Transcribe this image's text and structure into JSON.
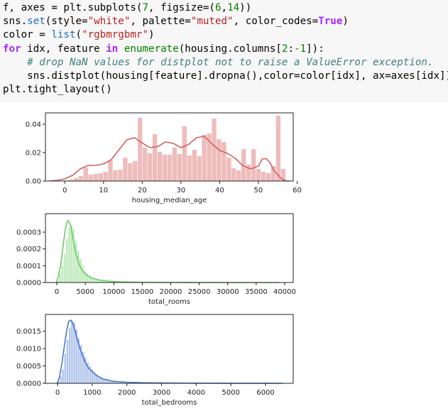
{
  "code": {
    "lines": [
      [
        {
          "t": "f, axes = plt.subplots(",
          "c": ""
        },
        {
          "t": "7",
          "c": "n"
        },
        {
          "t": ", figsize=(",
          "c": ""
        },
        {
          "t": "6",
          "c": "n"
        },
        {
          "t": ",",
          "c": ""
        },
        {
          "t": "14",
          "c": "n"
        },
        {
          "t": "))",
          "c": ""
        }
      ],
      [
        {
          "t": "sns.",
          "c": ""
        },
        {
          "t": "set",
          "c": "bl"
        },
        {
          "t": "(style=",
          "c": ""
        },
        {
          "t": "\"white\"",
          "c": "s"
        },
        {
          "t": ", palette=",
          "c": ""
        },
        {
          "t": "\"muted\"",
          "c": "s"
        },
        {
          "t": ", color_codes=",
          "c": ""
        },
        {
          "t": "True",
          "c": "kw"
        },
        {
          "t": ")",
          "c": ""
        }
      ],
      [
        {
          "t": "color = ",
          "c": ""
        },
        {
          "t": "list",
          "c": "bl"
        },
        {
          "t": "(",
          "c": ""
        },
        {
          "t": "\"rgbmrgbmr\"",
          "c": "s"
        },
        {
          "t": ")",
          "c": ""
        }
      ],
      [
        {
          "t": "for",
          "c": "kw"
        },
        {
          "t": " idx, feature ",
          "c": ""
        },
        {
          "t": "in",
          "c": "kw"
        },
        {
          "t": " ",
          "c": ""
        },
        {
          "t": "enumerate",
          "c": "b"
        },
        {
          "t": "(housing.columns[",
          "c": ""
        },
        {
          "t": "2",
          "c": "n"
        },
        {
          "t": ":",
          "c": ""
        },
        {
          "t": "-1",
          "c": "n"
        },
        {
          "t": "]):",
          "c": ""
        }
      ],
      [
        {
          "t": "    ",
          "c": ""
        },
        {
          "t": "# drop NaN values for distplot not to raise a ValueError exception.",
          "c": "c"
        }
      ],
      [
        {
          "t": "    sns.distplot(housing[feature].dropna(),color=color[idx], ax=axes[idx])",
          "c": ""
        }
      ],
      [
        {
          "t": "plt.tight_layout()",
          "c": ""
        }
      ]
    ]
  },
  "chart_data": [
    {
      "type": "histogram+kde",
      "xlabel": "housing_median_age",
      "ylabel": "",
      "color": "#d65f5f",
      "xlim": [
        -5,
        59
      ],
      "ylim": [
        0,
        0.048
      ],
      "xticks": [
        "0",
        "10",
        "20",
        "30",
        "40",
        "50",
        "60"
      ],
      "yticks": [
        "0.00",
        "0.02",
        "0.04"
      ],
      "bin_start": 1,
      "bin_width": 1.275,
      "hist_values": [
        0.001,
        0.002,
        0.0035,
        0.0095,
        0.0045,
        0.005,
        0.0055,
        0.0065,
        0.0145,
        0.0075,
        0.008,
        0.0165,
        0.0125,
        0.014,
        0.0445,
        0.0235,
        0.0195,
        0.033,
        0.0205,
        0.0185,
        0.0185,
        0.0235,
        0.019,
        0.0385,
        0.018,
        0.022,
        0.0175,
        0.0325,
        0.0335,
        0.044,
        0.0295,
        0.0275,
        0.0165,
        0.009,
        0.0075,
        0.0225,
        0.0115,
        0.0225,
        0.0085,
        0.0065,
        0.0055,
        0.0105,
        0.046,
        0.0085
      ],
      "kde_x": [
        -4,
        -2,
        0,
        2,
        4,
        6,
        8,
        10,
        12,
        14,
        16,
        18,
        20,
        22,
        24,
        26,
        28,
        30,
        32,
        34,
        36,
        38,
        40,
        42,
        44,
        46,
        48,
        50,
        51,
        52,
        53,
        54,
        56,
        57,
        58
      ],
      "kde_y": [
        0,
        0.0005,
        0.0015,
        0.004,
        0.0085,
        0.011,
        0.011,
        0.012,
        0.015,
        0.022,
        0.029,
        0.0305,
        0.0268,
        0.0235,
        0.0242,
        0.0275,
        0.0265,
        0.0235,
        0.0258,
        0.0305,
        0.0315,
        0.0262,
        0.0215,
        0.0195,
        0.016,
        0.0108,
        0.0085,
        0.0105,
        0.0155,
        0.0158,
        0.013,
        0.0075,
        0.0015,
        0.0003,
        0
      ]
    },
    {
      "type": "histogram+kde",
      "xlabel": "total_rooms",
      "ylabel": "",
      "color": "#6acc65",
      "xlim": [
        -2000,
        41500
      ],
      "ylim": [
        0,
        0.00041
      ],
      "xticks": [
        "0",
        "5000",
        "10000",
        "15000",
        "20000",
        "25000",
        "30000",
        "35000",
        "40000"
      ],
      "yticks": [
        "0.0000",
        "0.0001",
        "0.0002",
        "0.0003"
      ],
      "bin_start": 0,
      "bin_width": 400,
      "hist_values": [
        1e-05,
        5e-05,
        0.0001,
        0.00017,
        0.00026,
        0.00033,
        0.00034,
        0.00032,
        0.00025,
        0.00019,
        0.00014,
        0.0001,
        7e-05,
        5e-05,
        4e-05,
        3e-05,
        2.5e-05,
        2e-05,
        1.5e-05,
        1e-05,
        8e-06,
        6e-06,
        5e-06,
        4e-06,
        3e-06,
        3e-06,
        2e-06,
        2e-06
      ],
      "kde_x": [
        -100,
        300,
        700,
        1100,
        1500,
        1900,
        2200,
        2500,
        2900,
        3300,
        3800,
        4300,
        5000,
        6000,
        7500,
        9000,
        11000,
        14000,
        18000,
        24000,
        30000,
        35000,
        39000
      ],
      "kde_y": [
        0,
        4e-05,
        0.00011,
        0.00022,
        0.00032,
        0.00037,
        0.00036,
        0.00033,
        0.00025,
        0.00018,
        0.00012,
        8e-05,
        5e-05,
        2.8e-05,
        1.5e-05,
        8e-06,
        4e-06,
        2e-06,
        1e-06,
        5e-07,
        2e-07,
        1e-07,
        0
      ]
    },
    {
      "type": "histogram+kde",
      "xlabel": "total_bedrooms",
      "ylabel": "",
      "color": "#4878cf",
      "xlim": [
        -350,
        6800
      ],
      "ylim": [
        0,
        0.00198
      ],
      "xticks": [
        "0",
        "1000",
        "2000",
        "3000",
        "4000",
        "5000",
        "6000"
      ],
      "yticks": [
        "0.0000",
        "0.0005",
        "0.0010",
        "0.0015"
      ],
      "bin_start": 0,
      "bin_width": 65,
      "hist_values": [
        5e-05,
        0.0002,
        0.0004,
        0.00085,
        0.00125,
        0.0016,
        0.0018,
        0.00175,
        0.00155,
        0.0013,
        0.0011,
        0.0009,
        0.00075,
        0.0006,
        0.0005,
        0.0004,
        0.00032,
        0.00026,
        0.0002,
        0.00016,
        0.00013,
        0.0001,
        8e-05,
        6e-05,
        5e-05,
        4e-05,
        3e-05,
        2.5e-05,
        2e-05,
        1.5e-05,
        1e-05,
        1e-05
      ],
      "kde_x": [
        -10,
        60,
        130,
        200,
        260,
        320,
        380,
        440,
        520,
        600,
        700,
        800,
        900,
        1100,
        1300,
        1600,
        2000,
        2600,
        3200,
        4000,
        5000,
        6000,
        6500
      ],
      "kde_y": [
        0,
        0.0002,
        0.0006,
        0.0011,
        0.0015,
        0.00178,
        0.00182,
        0.00172,
        0.00145,
        0.00115,
        0.00085,
        0.0006,
        0.00043,
        0.00024,
        0.00013,
        6e-05,
        3e-05,
        1.5e-05,
        1e-05,
        5e-06,
        3e-06,
        2e-06,
        0
      ]
    }
  ]
}
